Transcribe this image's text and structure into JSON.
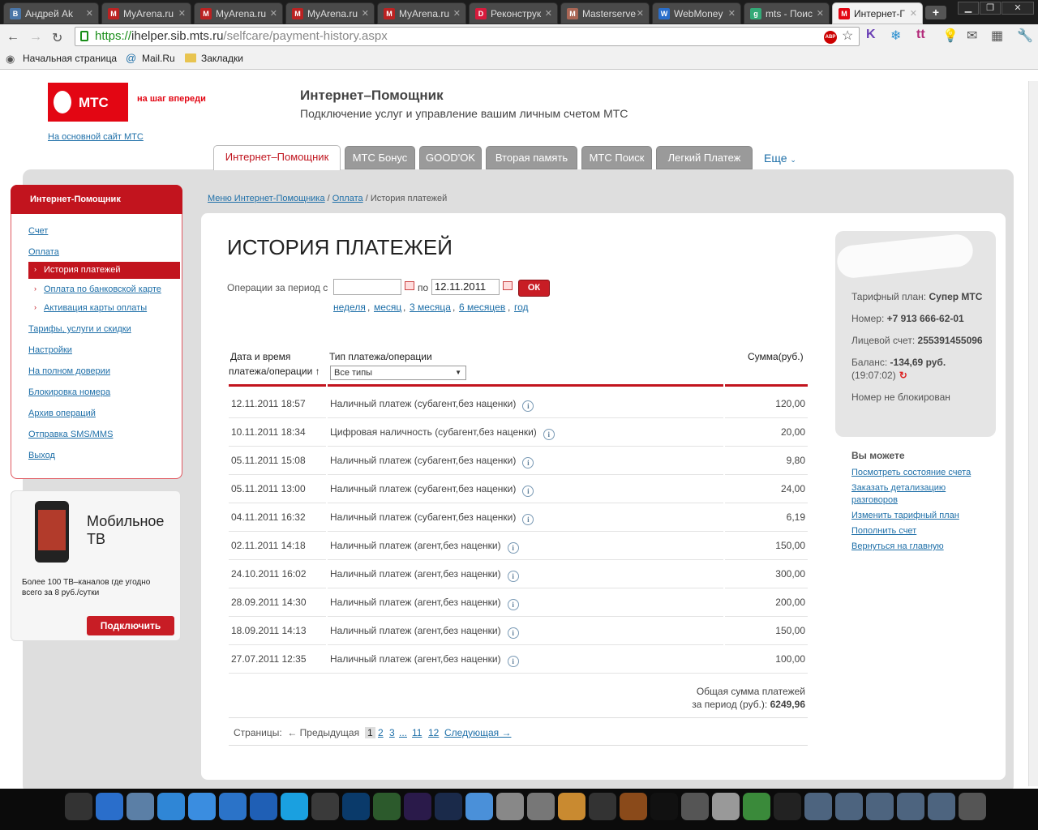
{
  "browser": {
    "tabs": [
      {
        "label": "Андрей Ak",
        "fav": "В",
        "fav_color": "#4a76a8"
      },
      {
        "label": "MyArena.ru",
        "fav": "M",
        "fav_color": "#b22"
      },
      {
        "label": "MyArena.ru",
        "fav": "M",
        "fav_color": "#b22"
      },
      {
        "label": "MyArena.ru",
        "fav": "M",
        "fav_color": "#b22"
      },
      {
        "label": "MyArena.ru",
        "fav": "M",
        "fav_color": "#b22"
      },
      {
        "label": "Реконструк",
        "fav": "D",
        "fav_color": "#d61a3c"
      },
      {
        "label": "Masterserve",
        "fav": "M",
        "fav_color": "#a65"
      },
      {
        "label": "WebMoney",
        "fav": "W",
        "fav_color": "#2a6ecb"
      },
      {
        "label": "mts - Поис",
        "fav": "g",
        "fav_color": "#3a7"
      },
      {
        "label": "Интернет-Г",
        "fav": "M",
        "fav_color": "#e30613"
      }
    ],
    "url_https": "https://",
    "url_host": "ihelper.sib.mts.ru",
    "url_path": "/selfcare/payment-history.aspx",
    "bookmarks": [
      "Начальная страница",
      "Mail.Ru",
      "Закладки"
    ]
  },
  "header": {
    "logo_text": "МТС",
    "slogan": "на шаг впереди",
    "main_site_link": "На основной сайт МТС",
    "title": "Интернет–Помощник",
    "subtitle": "Подключение услуг и управление вашим личным счетом МТС",
    "tabs": [
      "Интернет–Помощник",
      "МТС Бонус",
      "GOOD'OK",
      "Вторая память",
      "МТС Поиск",
      "Легкий Платеж"
    ],
    "more": "Еще"
  },
  "sidebar": {
    "title": "Интернет-Помощник",
    "items": [
      {
        "label": "Счет"
      },
      {
        "label": "Оплата"
      },
      {
        "label": "История платежей"
      },
      {
        "label": "Оплата по банковской карте"
      },
      {
        "label": "Активация карты оплаты"
      },
      {
        "label": "Тарифы, услуги и скидки"
      },
      {
        "label": "Настройки"
      },
      {
        "label": "На полном доверии"
      },
      {
        "label": "Блокировка номера"
      },
      {
        "label": "Архив операций"
      },
      {
        "label": "Отправка SMS/MMS"
      },
      {
        "label": "Выход"
      }
    ]
  },
  "ad": {
    "title_line1": "Мобильное",
    "title_line2": "ТВ",
    "text": "Более 100 ТВ–каналов где угодно всего за 8 руб./сутки",
    "button": "Подключить"
  },
  "breadcrumb": {
    "item1": "Меню Интернет-Помощника",
    "sep": "/",
    "item2": "Оплата",
    "current": "История платежей"
  },
  "main": {
    "title": "ИСТОРИЯ ПЛАТЕЖЕЙ",
    "period_label": "Операции за период с",
    "date_from": "",
    "to_label": "по",
    "date_to": "12.11.2011",
    "ok": "ОК",
    "quick_links": [
      "неделя",
      "месяц",
      "3 месяца",
      "6 месяцев",
      "год"
    ],
    "col_date_line1": "Дата и время",
    "col_date_line2": "платежа/операции ↑",
    "col_type": "Тип платежа/операции",
    "type_select": "Все типы",
    "col_amount": "Сумма(руб.)",
    "rows": [
      {
        "date": "12.11.2011 18:57",
        "type": "Наличный платеж (субагент,без наценки)",
        "amount": "120,00"
      },
      {
        "date": "10.11.2011 18:34",
        "type": "Цифровая наличность (субагент,без наценки)",
        "amount": "20,00"
      },
      {
        "date": "05.11.2011 15:08",
        "type": "Наличный платеж (субагент,без наценки)",
        "amount": "9,80"
      },
      {
        "date": "05.11.2011 13:00",
        "type": "Наличный платеж (субагент,без наценки)",
        "amount": "24,00"
      },
      {
        "date": "04.11.2011 16:32",
        "type": "Наличный платеж (субагент,без наценки)",
        "amount": "6,19"
      },
      {
        "date": "02.11.2011 14:18",
        "type": "Наличный платеж (агент,без наценки)",
        "amount": "150,00"
      },
      {
        "date": "24.10.2011 16:02",
        "type": "Наличный платеж (агент,без наценки)",
        "amount": "300,00"
      },
      {
        "date": "28.09.2011 14:30",
        "type": "Наличный платеж (агент,без наценки)",
        "amount": "200,00"
      },
      {
        "date": "18.09.2011 14:13",
        "type": "Наличный платеж (агент,без наценки)",
        "amount": "150,00"
      },
      {
        "date": "27.07.2011 12:35",
        "type": "Наличный платеж (агент,без наценки)",
        "amount": "100,00"
      }
    ],
    "total_line1": "Общая сумма платежей",
    "total_line2": "за период (руб.):",
    "total_value": "6249,96",
    "pager": {
      "label": "Страницы:",
      "prev": "← Предыдущая",
      "current": "1",
      "pages": [
        "2",
        "3",
        "...",
        "11",
        "12"
      ],
      "next": "Следующая →"
    }
  },
  "account": {
    "tariff_label": "Тарифный план:",
    "tariff": "Супер МТС",
    "number_label": "Номер:",
    "number": "+7 913 666-62-01",
    "account_label": "Лицевой счет:",
    "account": "255391455096",
    "balance_label": "Баланс:",
    "balance": "-134,69 руб.",
    "balance_time": "(19:07:02)",
    "status": "Номер не блокирован"
  },
  "actions": {
    "title": "Вы можете",
    "links": [
      "Посмотреть состояние счета",
      "Заказать детализацию разговоров",
      "Изменить тарифный план",
      "Пополнить счет",
      "Вернуться на главную"
    ]
  },
  "taskbar_icons": [
    "finder",
    "app-store",
    "preview",
    "safari-alt",
    "safari",
    "itunes",
    "quicktime",
    "skype",
    "time-machine",
    "photoshop",
    "dreamweaver",
    "premiere",
    "after-effects",
    "mobileme",
    "drive",
    "hd",
    "imovie",
    "star",
    "guitar",
    "terminal",
    "dashboard",
    "preferences",
    "adium",
    "steam",
    "folder",
    "folder",
    "folder",
    "folder",
    "folder",
    "drive"
  ]
}
